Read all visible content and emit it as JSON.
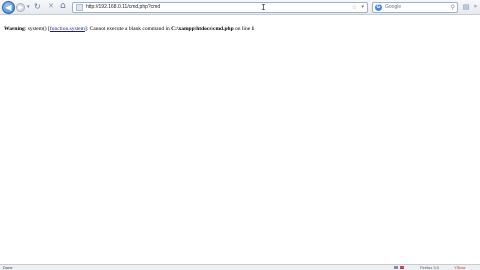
{
  "toolbar": {
    "back_glyph": "◀",
    "forward_glyph": "▶",
    "dropdown_glyph": "▾",
    "reload_glyph": "↻",
    "stop_glyph": "✕",
    "home_glyph": "⌂",
    "address": "http://192.168.0.11/cmd.php?cmd",
    "star_glyph": "☆",
    "address_drop_glyph": "▾",
    "search_engine_glyph": "G",
    "search_placeholder": "Google",
    "search_glyph": "⚲",
    "bookmark_glyph": "▤",
    "overflow_glyph": "»"
  },
  "page": {
    "warning_label": "Warning",
    "warning_prefix": ": system() [",
    "function_link": "function.system",
    "warning_message": "]: Cannot execute a blank command in ",
    "file_path": "C:\\xampp\\htdocs\\cmd.php",
    "line_prefix": " on line ",
    "line_number": "1"
  },
  "statusbar": {
    "status": "Done",
    "right_text": "Firefox 3.5",
    "ext_text": "YSlow"
  },
  "colors": {
    "link": "#1a1aa6",
    "accent": "#3f7fc9"
  }
}
